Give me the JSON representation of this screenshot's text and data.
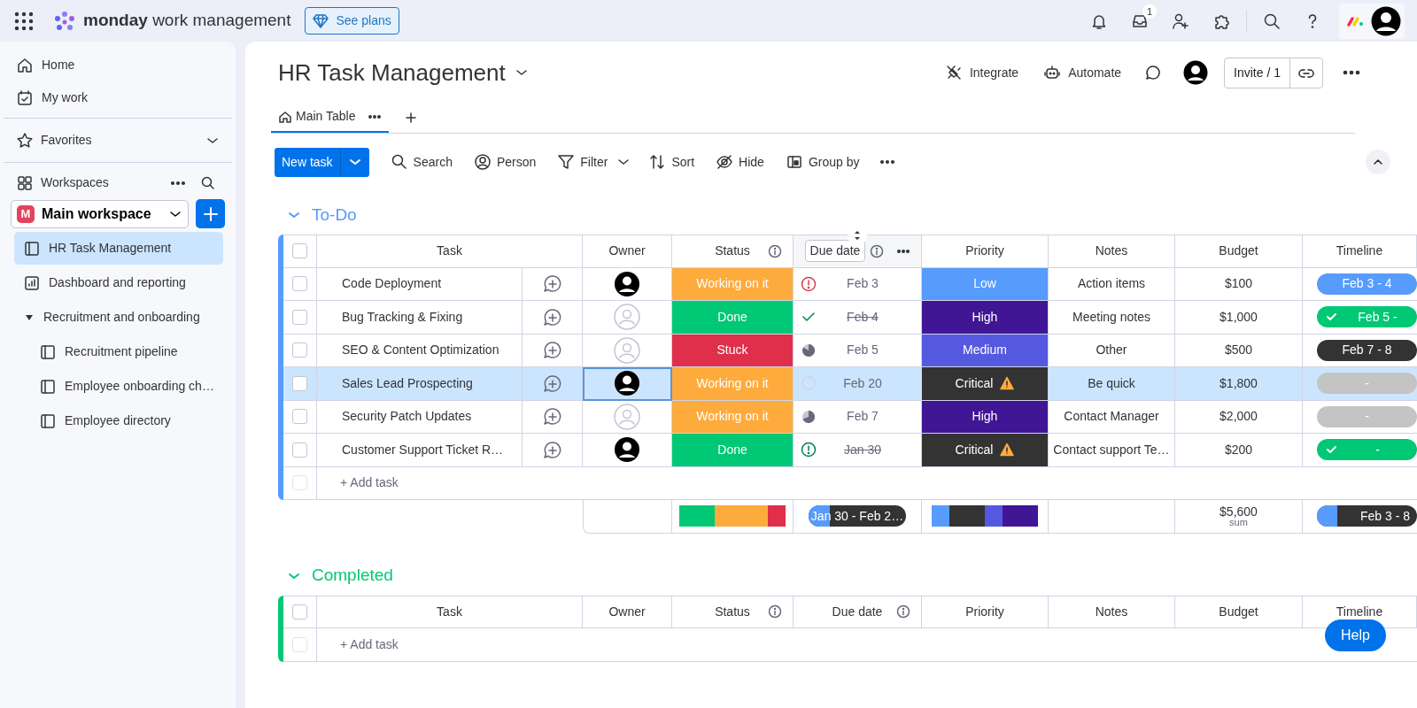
{
  "topbar": {
    "product_bold": "monday",
    "product_rest": "work management",
    "plans_button": "See plans",
    "inbox_badge": "1"
  },
  "sidebar": {
    "nav": [
      {
        "label": "Home"
      },
      {
        "label": "My work"
      }
    ],
    "favorites": "Favorites",
    "workspaces": "Workspaces",
    "workspace": {
      "initial": "M",
      "name": "Main workspace"
    },
    "items": [
      {
        "label": "HR Task Management",
        "kind": "board",
        "selected": true
      },
      {
        "label": "Dashboard and reporting",
        "kind": "dashboard",
        "selected": false
      },
      {
        "label": "Recruitment and onboarding",
        "kind": "folder",
        "selected": false,
        "expanded": true,
        "children": [
          {
            "label": "Recruitment pipeline",
            "kind": "board",
            "selected": false
          },
          {
            "label": "Employee onboarding ch…",
            "kind": "board",
            "selected": false
          },
          {
            "label": "Employee directory",
            "kind": "board",
            "selected": false
          }
        ]
      }
    ]
  },
  "board": {
    "title": "HR Task Management",
    "actions": [
      "Integrate",
      "Automate"
    ],
    "invite": "Invite / 1",
    "views": [
      {
        "label": "Main Table",
        "selected": true
      }
    ],
    "toolbar": {
      "new_task": "New task",
      "items": [
        "Search",
        "Person",
        "Filter",
        "Sort",
        "Hide",
        "Group by"
      ]
    }
  },
  "groups": [
    {
      "title": "To-Do",
      "color": "#579bfc",
      "expanded": true,
      "columns": [
        {
          "label": "Task",
          "info": false,
          "hovered": false
        },
        {
          "label": "Owner",
          "info": false,
          "hovered": false
        },
        {
          "label": "Status",
          "info": true,
          "hovered": false
        },
        {
          "label": "Due date",
          "info": true,
          "hovered": true
        },
        {
          "label": "Priority",
          "info": false,
          "hovered": false
        },
        {
          "label": "Notes",
          "info": false,
          "hovered": false
        },
        {
          "label": "Budget",
          "info": false,
          "hovered": false
        },
        {
          "label": "Timeline",
          "info": false,
          "hovered": false
        }
      ],
      "rows": [
        {
          "task": "Code Deployment",
          "checked": false,
          "selected": false,
          "owner": {
            "kind": "person"
          },
          "status": {
            "label": "Working on it",
            "color": "#fdab3d"
          },
          "due": {
            "label": "Feb 3",
            "done": false,
            "icon": {
              "kind": "alert",
              "color": "#d83a52"
            }
          },
          "priority": {
            "label": "Low",
            "color": "#579bfc",
            "warning": false
          },
          "notes": "Action items",
          "budget": "$100",
          "timeline": {
            "label": "Feb 3 - 4",
            "color": "#579bfc",
            "done": false
          }
        },
        {
          "task": "Bug Tracking & Fixing",
          "checked": false,
          "selected": false,
          "owner": {
            "kind": "empty"
          },
          "status": {
            "label": "Done",
            "color": "#00c875"
          },
          "due": {
            "label": "Feb 4",
            "done": true,
            "icon": {
              "kind": "check",
              "color": "#037f4c"
            }
          },
          "priority": {
            "label": "High",
            "color": "#401694",
            "warning": false
          },
          "notes": "Meeting notes",
          "budget": "$1,000",
          "timeline": {
            "label": "Feb 5 -",
            "color": "#00c875",
            "done": true
          }
        },
        {
          "task": "SEO & Content Optimization",
          "checked": false,
          "selected": false,
          "owner": {
            "kind": "empty"
          },
          "status": {
            "label": "Stuck",
            "color": "#df2f4a"
          },
          "due": {
            "label": "Feb 5",
            "done": false,
            "icon": {
              "kind": "pie_large",
              "color": "#676879"
            }
          },
          "priority": {
            "label": "Medium",
            "color": "#5559df",
            "warning": false
          },
          "notes": "Other",
          "budget": "$500",
          "timeline": {
            "label": "Feb 7 - 8",
            "color": "#333333",
            "done": false
          }
        },
        {
          "task": "Sales Lead Prospecting",
          "checked": false,
          "selected": true,
          "owner": {
            "kind": "person"
          },
          "status": {
            "label": "Working on it",
            "color": "#fdab3d"
          },
          "due": {
            "label": "Feb 20",
            "done": false,
            "icon": {
              "kind": "empty",
              "color": "#d0d4e4"
            }
          },
          "priority": {
            "label": "Critical",
            "color": "#333333",
            "warning": true
          },
          "notes": "Be quick",
          "budget": "$1,800",
          "timeline": {
            "label": "-",
            "color": "#c4c4c4",
            "done": false
          }
        },
        {
          "task": "Security Patch Updates",
          "checked": false,
          "selected": false,
          "owner": {
            "kind": "empty"
          },
          "status": {
            "label": "Working on it",
            "color": "#fdab3d"
          },
          "due": {
            "label": "Feb 7",
            "done": false,
            "icon": {
              "kind": "pie_half",
              "color": "#676879"
            }
          },
          "priority": {
            "label": "High",
            "color": "#401694",
            "warning": false
          },
          "notes": "Contact Manager",
          "budget": "$2,000",
          "timeline": {
            "label": "-",
            "color": "#c4c4c4",
            "done": false
          }
        },
        {
          "task": "Customer Support Ticket R…",
          "checked": false,
          "selected": false,
          "owner": {
            "kind": "person"
          },
          "status": {
            "label": "Done",
            "color": "#00c875"
          },
          "due": {
            "label": "Jan 30",
            "done": true,
            "icon": {
              "kind": "alert",
              "color": "#037f4c"
            }
          },
          "priority": {
            "label": "Critical",
            "color": "#333333",
            "warning": true
          },
          "notes": "Contact support Te…",
          "budget": "$200",
          "timeline": {
            "label": "-",
            "color": "#00c875",
            "done": true
          }
        }
      ],
      "all_checked": false,
      "add_task": "+ Add task",
      "new_row_checked": false,
      "summary": {
        "status_bar": [
          {
            "color": "#00c875"
          },
          {
            "color": "#fdab3d"
          },
          {
            "color": "#df2f4a"
          }
        ],
        "due": {
          "label": "Jan 30 - Feb 2…",
          "level": 0.22
        },
        "priority_bar": [
          {
            "color": "#579bfc"
          },
          {
            "color": "#333333"
          },
          {
            "color": "#5559df"
          },
          {
            "color": "#401694"
          }
        ],
        "budget": "$5,600",
        "budget_caption": "sum",
        "timeline": {
          "label": "Feb 3 - 8",
          "level": 0.2
        }
      }
    },
    {
      "title": "Completed",
      "color": "#00c875",
      "expanded": true,
      "columns": [
        {
          "label": "Task",
          "info": false,
          "hovered": false
        },
        {
          "label": "Owner",
          "info": false,
          "hovered": false
        },
        {
          "label": "Status",
          "info": true,
          "hovered": false
        },
        {
          "label": "Due date",
          "info": true,
          "hovered": false
        },
        {
          "label": "Priority",
          "info": false,
          "hovered": false
        },
        {
          "label": "Notes",
          "info": false,
          "hovered": false
        },
        {
          "label": "Budget",
          "info": false,
          "hovered": false
        },
        {
          "label": "Timeline",
          "info": false,
          "hovered": false
        }
      ],
      "all_checked": false,
      "add_task": "+ Add task",
      "new_row_checked": false
    }
  ],
  "help_button": "Help"
}
